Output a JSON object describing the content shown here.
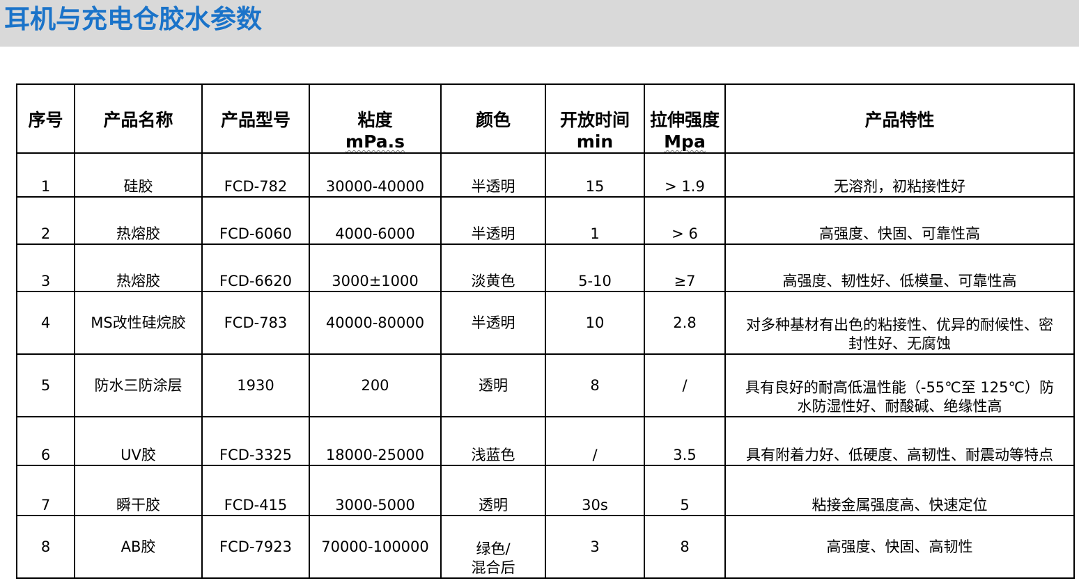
{
  "page": {
    "title": "耳机与充电仓胶水参数",
    "title_color": "#1a73c9",
    "title_bar_color": "#d9d9d9"
  },
  "table": {
    "headers": [
      {
        "main": "序号",
        "unit": ""
      },
      {
        "main": "产品名称",
        "unit": ""
      },
      {
        "main": "产品型号",
        "unit": ""
      },
      {
        "main": "粘度",
        "unit": "mPa.s"
      },
      {
        "main": "颜色",
        "unit": ""
      },
      {
        "main": "开放时间",
        "unit": "min"
      },
      {
        "main": "拉伸强度",
        "unit": "Mpa"
      },
      {
        "main": "产品特性",
        "unit": ""
      }
    ],
    "rows": [
      {
        "no": "1",
        "name": "硅胶",
        "model": "FCD-782",
        "viscosity": "30000-40000",
        "color": [
          "半透明"
        ],
        "open_time": "15",
        "tensile": "> 1.9",
        "feature": [
          "无溶剂，初粘接性好"
        ]
      },
      {
        "no": "2",
        "name": "热熔胶",
        "model": "FCD-6060",
        "viscosity": "4000-6000",
        "color": [
          "半透明"
        ],
        "open_time": "1",
        "tensile": "> 6",
        "feature": [
          "高强度、快固、可靠性高"
        ]
      },
      {
        "no": "3",
        "name": "热熔胶",
        "model": "FCD-6620",
        "viscosity": "3000±1000",
        "color": [
          "淡黄色"
        ],
        "open_time": "5-10",
        "tensile": "≥7",
        "feature": [
          "高强度、韧性好、低模量、可靠性高"
        ]
      },
      {
        "no": "4",
        "name": "MS改性硅烷胶",
        "model": "FCD-783",
        "viscosity": "40000-80000",
        "color": [
          "半透明"
        ],
        "open_time": "10",
        "tensile": "2.8",
        "feature": [
          "对多种基材有出色的粘接性、优异的耐候性、密",
          "封性好、无腐蚀"
        ]
      },
      {
        "no": "5",
        "name": "防水三防涂层",
        "model": "1930",
        "viscosity": "200",
        "color": [
          "透明"
        ],
        "open_time": "8",
        "tensile": "/",
        "feature": [
          "具有良好的耐高低温性能（-55℃至 125℃）防",
          "水防湿性好、耐酸碱、绝缘性高"
        ]
      },
      {
        "no": "6",
        "name": "UV胶",
        "model": "FCD-3325",
        "viscosity": "18000-25000",
        "color": [
          "浅蓝色"
        ],
        "open_time": "/",
        "tensile": "3.5",
        "feature": [
          "具有附着力好、低硬度、高韧性、耐震动等特点"
        ]
      },
      {
        "no": "7",
        "name": "瞬干胶",
        "model": "FCD-415",
        "viscosity": "3000-5000",
        "color": [
          "透明"
        ],
        "open_time": "30s",
        "tensile": "5",
        "feature": [
          "粘接金属强度高、快速定位"
        ]
      },
      {
        "no": "8",
        "name": "AB胶",
        "model": "FCD-7923",
        "viscosity": "70000-100000",
        "color": [
          "绿色/",
          "混合后"
        ],
        "open_time": "3",
        "tensile": "8",
        "feature": [
          "高强度、快固、高韧性"
        ]
      }
    ]
  }
}
